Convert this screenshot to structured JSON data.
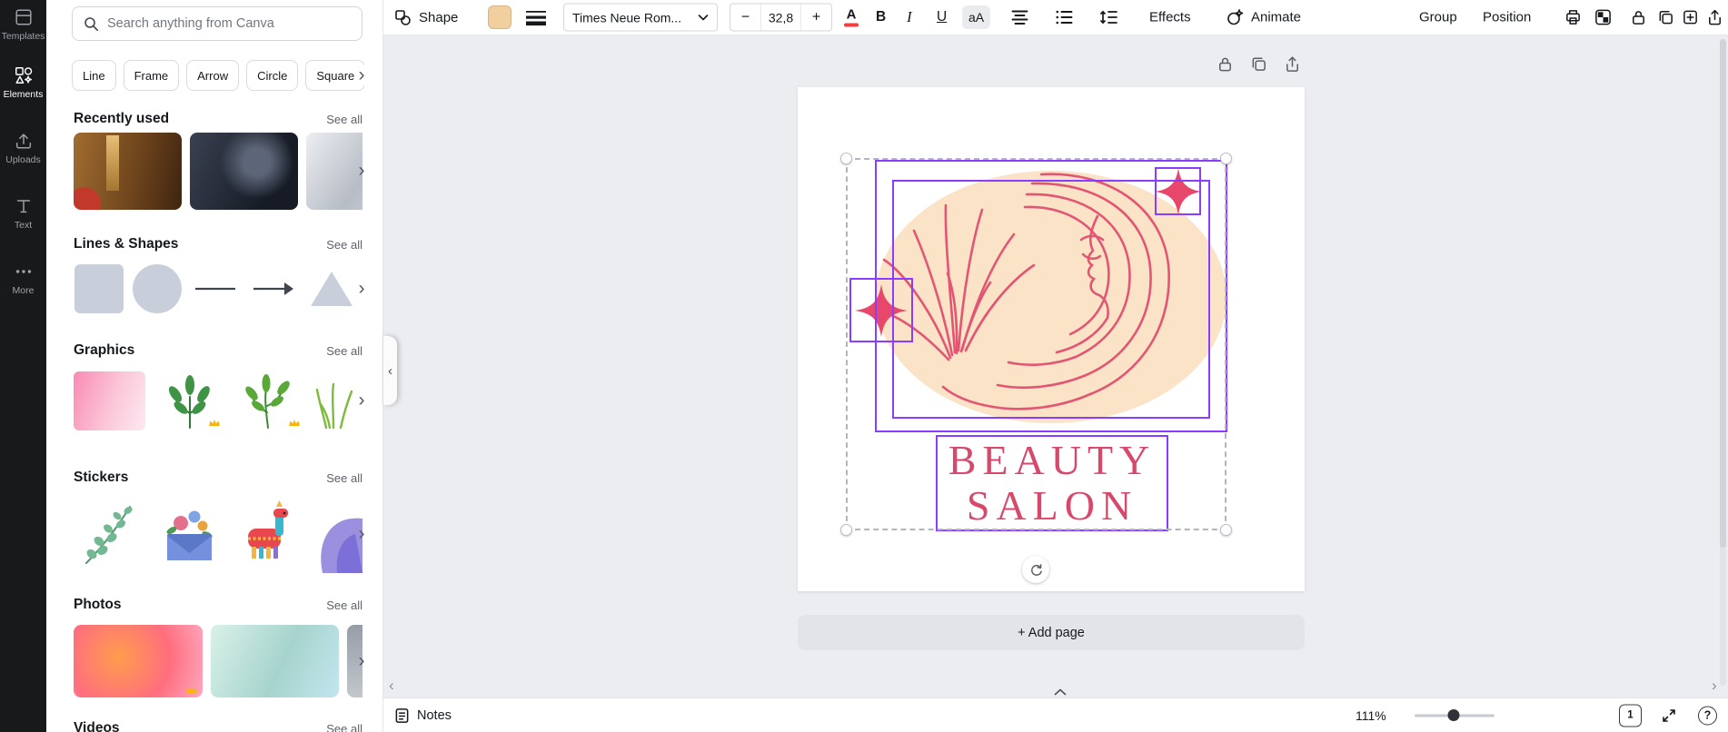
{
  "nav_rail": {
    "items": [
      {
        "label": "Templates"
      },
      {
        "label": "Elements"
      },
      {
        "label": "Uploads"
      },
      {
        "label": "Text"
      },
      {
        "label": "More"
      }
    ]
  },
  "sidebar": {
    "search_placeholder": "Search anything from Canva",
    "chips": [
      "Line",
      "Frame",
      "Arrow",
      "Circle",
      "Square"
    ],
    "sections": [
      {
        "title": "Recently used",
        "see_all": "See all"
      },
      {
        "title": "Lines & Shapes",
        "see_all": "See all"
      },
      {
        "title": "Graphics",
        "see_all": "See all"
      },
      {
        "title": "Stickers",
        "see_all": "See all"
      },
      {
        "title": "Photos",
        "see_all": "See all"
      },
      {
        "title": "Videos",
        "see_all": "See all"
      }
    ]
  },
  "toolbar": {
    "shape_label": "Shape",
    "font_name": "Times Neue Rom...",
    "font_size": "32,8",
    "text_color": "A",
    "bold": "B",
    "italic": "I",
    "underline": "U",
    "case_toggle": "aA",
    "effects_label": "Effects",
    "animate_label": "Animate",
    "group_label": "Group",
    "position_label": "Position"
  },
  "canvas": {
    "design": {
      "line1": "BEAUTY",
      "line2": "SALON"
    },
    "add_page_label": "+ Add page"
  },
  "statusbar": {
    "notes_label": "Notes",
    "zoom_percent": "111%",
    "page_number": "1"
  },
  "icons": {
    "chevron_right": "›",
    "chevron_left": "‹",
    "plus": "+",
    "minus": "−",
    "help": "?"
  },
  "colors": {
    "accent_purple": "#8b3dff",
    "brand_pink": "#e25673",
    "peach_fill": "#fbe3c7",
    "shape_swatch": "#f2cf9f",
    "rail_bg": "#18191b"
  }
}
